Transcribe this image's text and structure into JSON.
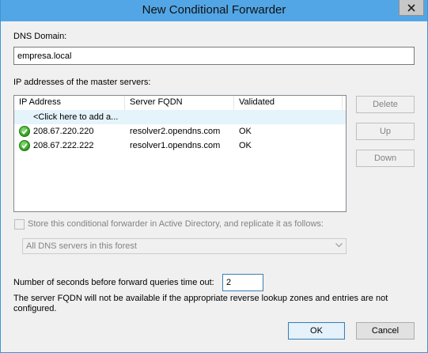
{
  "window": {
    "title": "New Conditional Forwarder"
  },
  "dns_domain": {
    "label": "DNS Domain:",
    "value": "empresa.local"
  },
  "master_servers": {
    "label": "IP addresses of the master servers:",
    "columns": [
      "IP Address",
      "Server FQDN",
      "Validated"
    ],
    "add_placeholder": "<Click here to add a...",
    "rows": [
      {
        "ip": "208.67.220.220",
        "fqdn": "resolver2.opendns.com",
        "validated": "OK",
        "icon": "check-circle-icon"
      },
      {
        "ip": "208.67.222.222",
        "fqdn": "resolver1.opendns.com",
        "validated": "OK",
        "icon": "check-circle-icon"
      }
    ]
  },
  "side_buttons": {
    "delete": "Delete",
    "up": "Up",
    "down": "Down"
  },
  "ad_store": {
    "label": "Store this conditional forwarder in Active Directory, and replicate it as follows:",
    "checked": false,
    "replication": "All DNS servers in this forest"
  },
  "timeout": {
    "label": "Number of seconds before forward queries time out:",
    "value": "2"
  },
  "note": "The server FQDN will not be available if the appropriate reverse lookup zones and entries are not configured.",
  "buttons": {
    "ok": "OK",
    "cancel": "Cancel"
  },
  "colors": {
    "titlebar": "#52a6e6",
    "ok_icon": "#2d9a1d"
  }
}
